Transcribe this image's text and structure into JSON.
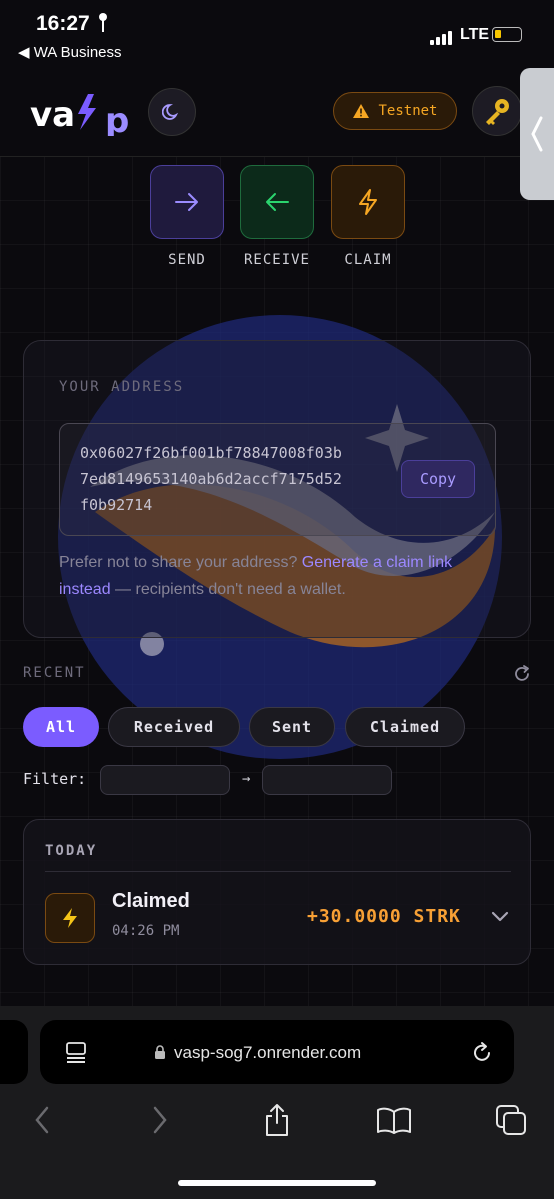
{
  "status_bar": {
    "time": "16:27",
    "back_app": "◀ WA Business",
    "network": "LTE",
    "battery_level": 0.25
  },
  "header": {
    "logo_text": "vasp",
    "testnet_label": "Testnet"
  },
  "actions": [
    {
      "label": "SEND",
      "icon": "arrow-right-icon",
      "color": "#9b8cff"
    },
    {
      "label": "RECEIVE",
      "icon": "arrow-left-icon",
      "color": "#2bd46e"
    },
    {
      "label": "CLAIM",
      "icon": "bolt-icon",
      "color": "#f5a623"
    }
  ],
  "address_card": {
    "title": "YOUR ADDRESS",
    "address_lines": [
      "0x06027f26bf001bf78847008f03b",
      "7ed8149653140ab6d2accf7175d52",
      "f0b92714"
    ],
    "copy_label": "Copy",
    "note_prefix": "Prefer not to share your address? ",
    "note_link": "Generate a claim link instead",
    "note_suffix": " — recipients don't need a wallet."
  },
  "recent": {
    "title": "RECENT",
    "filters": [
      "All",
      "Received",
      "Sent",
      "Claimed"
    ],
    "active_filter": "All",
    "filter_label": "Filter:",
    "range_arrow": "→",
    "from_value": "",
    "to_value": ""
  },
  "transactions": {
    "group": "TODAY",
    "items": [
      {
        "type": "Claimed",
        "time": "04:26 PM",
        "amount": "+30.0000 STRK"
      }
    ]
  },
  "safari": {
    "url": "vasp-sog7.onrender.com"
  },
  "colors": {
    "accent": "#7b5cff",
    "warning": "#f5a623",
    "success": "#2bd46e"
  }
}
